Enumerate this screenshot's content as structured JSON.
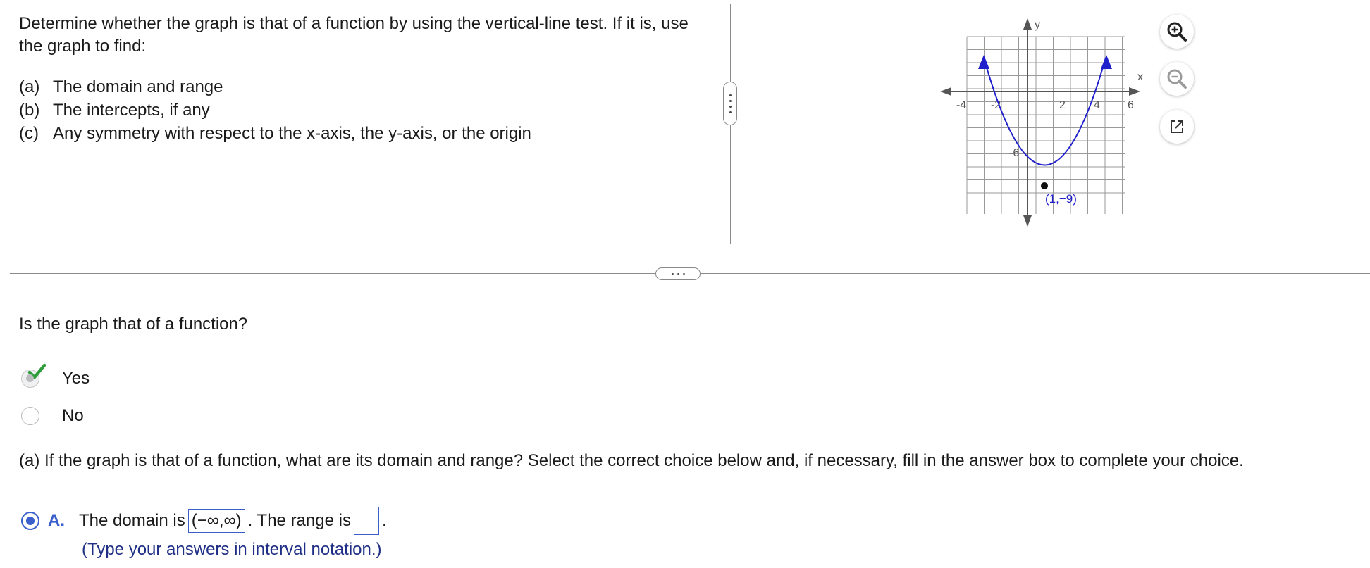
{
  "problem": {
    "prompt": "Determine whether the graph is that of a function by using the vertical-line test. If it is, use the graph to find:",
    "parts": [
      {
        "label": "(a)",
        "text": "The domain and range"
      },
      {
        "label": "(b)",
        "text": "The intercepts, if any"
      },
      {
        "label": "(c)",
        "text": "Any symmetry with respect to the x-axis, the y-axis, or the origin"
      }
    ]
  },
  "graph": {
    "axis_x_label": "x",
    "axis_y_label": "y",
    "x_ticks": [
      "-4",
      "-2",
      "2",
      "4",
      "6"
    ],
    "y_tick": "-6",
    "vertex_label": "(1,−9)",
    "curve_color": "#1f1fcc"
  },
  "toolbar": {
    "zoom_in": "zoom-in-icon",
    "zoom_out": "zoom-out-icon",
    "popout": "popout-icon"
  },
  "question": {
    "text": "Is the graph that of a function?",
    "options": [
      {
        "label": "Yes",
        "selected": true
      },
      {
        "label": "No",
        "selected": false
      }
    ]
  },
  "part_a": {
    "text": "(a) If the graph is that of a function, what are its domain and range? Select the correct choice below and, if necessary, fill in the answer box to complete your choice.",
    "choice_letter": "A.",
    "domain_prefix": "The domain is",
    "domain_value": "(−∞,∞)",
    "range_prefix": ". The range is",
    "range_value": "",
    "range_suffix": ".",
    "hint": "(Type your answers in interval notation.)"
  },
  "colors": {
    "accent": "#3a5fcd",
    "check": "#2e9e3a",
    "hint": "#1f2f86"
  }
}
